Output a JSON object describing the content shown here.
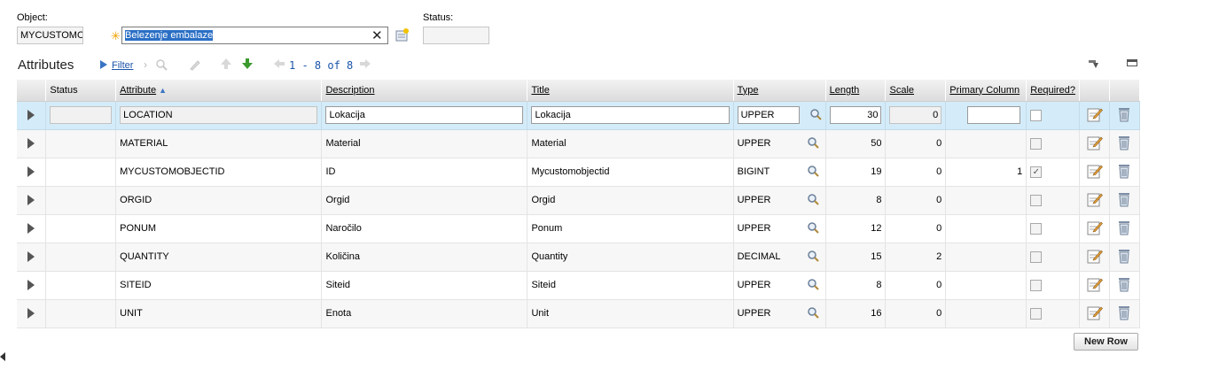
{
  "header": {
    "object_label": "Object:",
    "object_value": "MYCUSTOMOBJECT",
    "description_value": "Belezenje embalaze",
    "status_label": "Status:",
    "status_value": ""
  },
  "toolbar": {
    "title": "Attributes",
    "filter_label": "Filter",
    "page_info": "1 - 8 of 8"
  },
  "grid": {
    "columns": [
      "Status",
      "Attribute",
      "Description",
      "Title",
      "Type",
      "Length",
      "Scale",
      "Primary Column",
      "Required?"
    ],
    "rows": [
      {
        "status": "",
        "attribute": "LOCATION",
        "description": "Lokacija",
        "title": "Lokacija",
        "type": "UPPER",
        "length": "30",
        "scale": "0",
        "primary": "",
        "required": false
      },
      {
        "status": "",
        "attribute": "MATERIAL",
        "description": "Material",
        "title": "Material",
        "type": "UPPER",
        "length": "50",
        "scale": "0",
        "primary": "",
        "required": false
      },
      {
        "status": "",
        "attribute": "MYCUSTOMOBJECTID",
        "description": "ID",
        "title": "Mycustomobjectid",
        "type": "BIGINT",
        "length": "19",
        "scale": "0",
        "primary": "1",
        "required": true
      },
      {
        "status": "",
        "attribute": "ORGID",
        "description": "Orgid",
        "title": "Orgid",
        "type": "UPPER",
        "length": "8",
        "scale": "0",
        "primary": "",
        "required": false
      },
      {
        "status": "",
        "attribute": "PONUM",
        "description": "Naročilo",
        "title": "Ponum",
        "type": "UPPER",
        "length": "12",
        "scale": "0",
        "primary": "",
        "required": false
      },
      {
        "status": "",
        "attribute": "QUANTITY",
        "description": "Količina",
        "title": "Quantity",
        "type": "DECIMAL",
        "length": "15",
        "scale": "2",
        "primary": "",
        "required": false
      },
      {
        "status": "",
        "attribute": "SITEID",
        "description": "Siteid",
        "title": "Siteid",
        "type": "UPPER",
        "length": "8",
        "scale": "0",
        "primary": "",
        "required": false
      },
      {
        "status": "",
        "attribute": "UNIT",
        "description": "Enota",
        "title": "Unit",
        "type": "UPPER",
        "length": "16",
        "scale": "0",
        "primary": "",
        "required": false
      }
    ]
  },
  "actions": {
    "new_row_label": "New Row"
  },
  "colors": {
    "selected_row": "#d4ecf9",
    "link": "#1a54a8",
    "required_star": "#f0a000"
  }
}
